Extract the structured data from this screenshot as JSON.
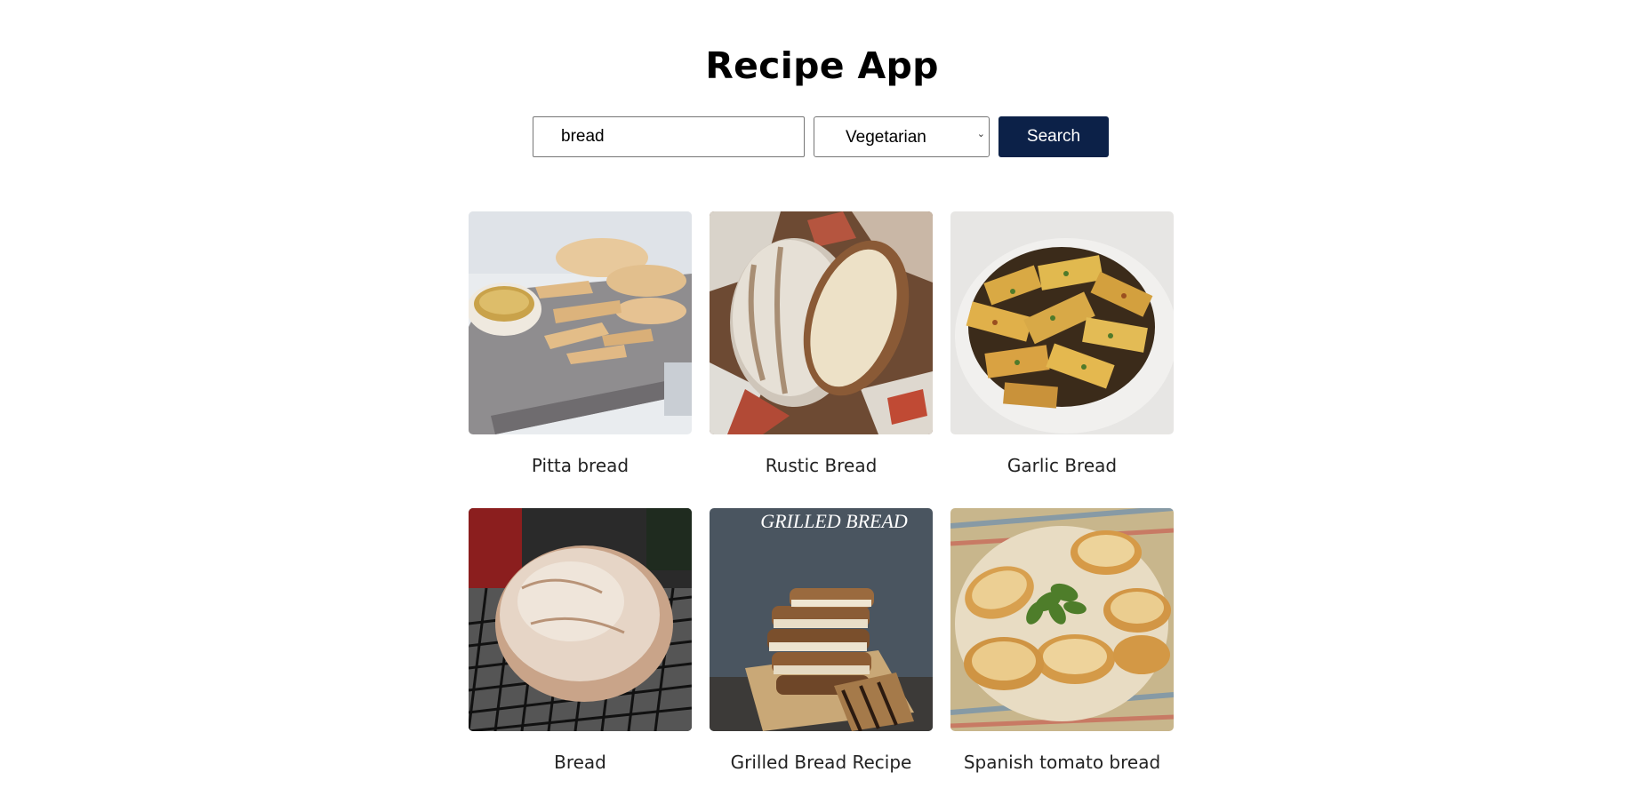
{
  "header": {
    "title": "Recipe App"
  },
  "search": {
    "query": "bread",
    "diet_filter": "Vegetarian",
    "button_label": "Search"
  },
  "recipes": [
    {
      "title": "Pitta bread",
      "image": "pitta-bread-photo"
    },
    {
      "title": "Rustic Bread",
      "image": "rustic-bread-photo"
    },
    {
      "title": "Garlic Bread",
      "image": "garlic-bread-photo"
    },
    {
      "title": "Bread",
      "image": "bread-loaf-photo"
    },
    {
      "title": "Grilled Bread Recipe",
      "image": "grilled-bread-photo",
      "image_caption": "GRILLED BREAD"
    },
    {
      "title": "Spanish tomato bread",
      "image": "spanish-tomato-bread-photo"
    }
  ],
  "colors": {
    "search_button_bg": "#0c2148",
    "background": "#ffffff"
  }
}
